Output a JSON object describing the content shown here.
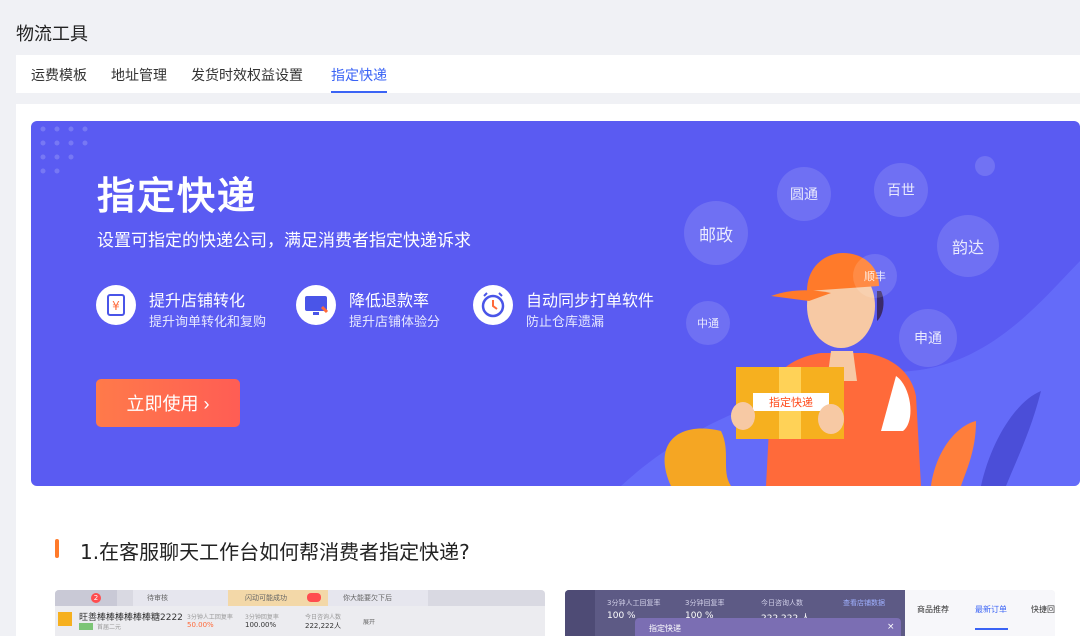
{
  "page": {
    "title": "物流工具"
  },
  "tabs": [
    {
      "label": "运费模板"
    },
    {
      "label": "地址管理"
    },
    {
      "label": "发货时效权益设置"
    },
    {
      "label": "指定快递",
      "active": true
    }
  ],
  "banner": {
    "title": "指定快递",
    "subtitle": "设置可指定的快递公司，满足消费者指定快递诉求",
    "features": [
      {
        "icon": "yen-document-icon",
        "title": "提升店铺转化",
        "desc": "提升询单转化和复购"
      },
      {
        "icon": "monitor-refund-icon",
        "title": "降低退款率",
        "desc": "提升店铺体验分"
      },
      {
        "icon": "alarm-clock-icon",
        "title": "自动同步打单软件",
        "desc": "防止仓库遗漏"
      }
    ],
    "cta_label": "立即使用 ›",
    "couriers": [
      "邮政",
      "圆通",
      "百世",
      "韵达",
      "顺丰",
      "中通",
      "申通"
    ],
    "box_label": "指定快递",
    "colors": {
      "background": "#5a5bf2",
      "cta": "#ff6a4f",
      "accent_bar": "#ff7a2a",
      "tab_active": "#3a63f5"
    }
  },
  "section": {
    "title": "1.在客服聊天工作台如何帮消费者指定快递?"
  },
  "preview_a": {
    "tab1": "待审核",
    "tab2": "闪动可能成功",
    "tab3": "你大能要欠下后",
    "badge": "2",
    "shop_name": "旺善棒棒棒棒棒棒糖2222",
    "tag": "首届二元",
    "stats": [
      {
        "label": "3分钟人工回复率",
        "value": "50.00%"
      },
      {
        "label": "3分钟回复率",
        "value": "100.00%"
      },
      {
        "label": "今日咨询人数",
        "value": "222,222人"
      }
    ],
    "more": "展开"
  },
  "preview_b": {
    "stats": [
      {
        "label": "3分钟人工回复率",
        "value": "100 %"
      },
      {
        "label": "3分钟回复率",
        "value": "100 %"
      },
      {
        "label": "今日咨询人数",
        "value": "222,222 人"
      }
    ],
    "link": "查看店铺数据",
    "tabs": [
      "商品推荐",
      "最新订单",
      "快捷回"
    ],
    "dialog_title": "指定快递",
    "close": "×"
  }
}
